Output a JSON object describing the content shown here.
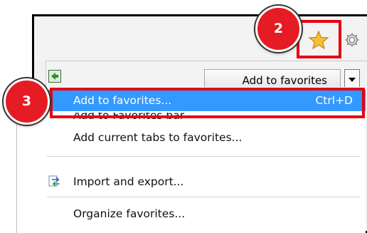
{
  "steps": {
    "star_step": "2",
    "menu_step": "3"
  },
  "toolbar": {
    "favorites_icon": "star-icon",
    "tools_icon": "gear-icon",
    "highlight_color": "#e8000f"
  },
  "favorites_panel": {
    "pin_icon": "pin-to-left-icon",
    "add_button_label": "Add to favorites",
    "dropdown_icon": "chevron-down-icon"
  },
  "menu": {
    "items": [
      {
        "label": "Add to favorites...",
        "shortcut": "Ctrl+D",
        "selected": true
      },
      {
        "label": "Add to Favorites bar"
      },
      {
        "label": "Add current tabs to favorites..."
      },
      {
        "label": "Import and export...",
        "icon": "import-export-icon"
      },
      {
        "label": "Organize favorites..."
      }
    ],
    "selected_color": "#3399ff"
  }
}
